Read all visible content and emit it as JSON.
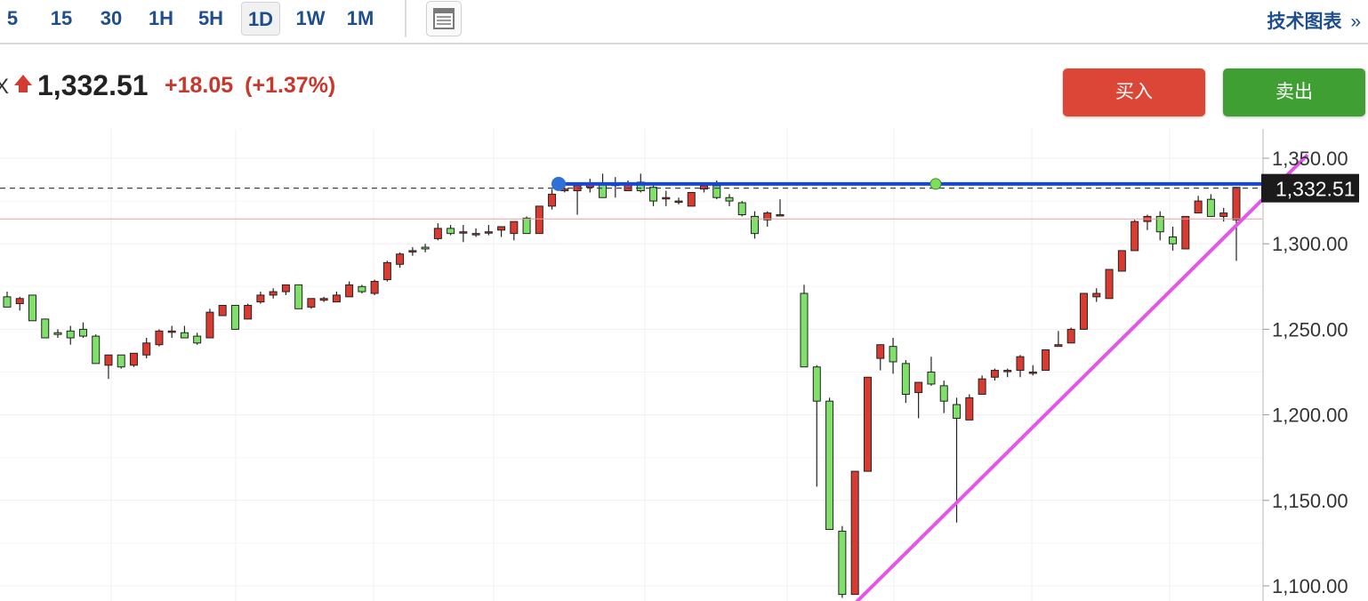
{
  "toolbar": {
    "timeframes": [
      "5",
      "15",
      "30",
      "1H",
      "5H",
      "1D",
      "1W",
      "1M"
    ],
    "active_timeframe": "1D",
    "layout_icon": "layout-icon",
    "tech_chart_label": "技术图表",
    "tech_chart_arrow": "»"
  },
  "quote": {
    "prefix": "X",
    "direction_icon": "up-arrow-icon",
    "last_price": "1,332.51",
    "change": "+18.05",
    "change_pct": "(+1.37%)",
    "up_color": "#c8372c"
  },
  "actions": {
    "buy_label": "买入",
    "sell_label": "卖出",
    "buy_color": "#dc4637",
    "sell_color": "#3f9f33"
  },
  "chart_data": {
    "type": "candlestick",
    "y_axis": {
      "ticks": [
        "1,100.00",
        "1,150.00",
        "1,200.00",
        "1,250.00",
        "1,300.00",
        "1,350.00"
      ],
      "ylim": [
        1092,
        1354
      ],
      "position": "right"
    },
    "current_price_label": "1,332.51",
    "grid": true,
    "up_color": "#d93b30",
    "down_color": "#7fe06a",
    "candles": [
      [
        1269,
        1272,
        1263,
        1263
      ],
      [
        1265,
        1269,
        1261,
        1268
      ],
      [
        1270,
        1270,
        1255,
        1255
      ],
      [
        1256,
        1256,
        1245,
        1245
      ],
      [
        1248,
        1250,
        1245,
        1247
      ],
      [
        1249,
        1252,
        1241,
        1245
      ],
      [
        1250,
        1254,
        1245,
        1246
      ],
      [
        1246,
        1247,
        1230,
        1230
      ],
      [
        1229,
        1234,
        1221,
        1235
      ],
      [
        1235,
        1235,
        1227,
        1228
      ],
      [
        1229,
        1236,
        1228,
        1236
      ],
      [
        1235,
        1245,
        1233,
        1242
      ],
      [
        1241,
        1250,
        1240,
        1249
      ],
      [
        1249,
        1252,
        1245,
        1249
      ],
      [
        1248,
        1252,
        1245,
        1245
      ],
      [
        1246,
        1248,
        1241,
        1242
      ],
      [
        1245,
        1262,
        1245,
        1260
      ],
      [
        1258,
        1264,
        1258,
        1264
      ],
      [
        1264,
        1264,
        1250,
        1250
      ],
      [
        1256,
        1265,
        1256,
        1264
      ],
      [
        1266,
        1272,
        1265,
        1270
      ],
      [
        1270,
        1274,
        1268,
        1272
      ],
      [
        1272,
        1276,
        1270,
        1276
      ],
      [
        1276,
        1276,
        1262,
        1262
      ],
      [
        1263,
        1268,
        1262,
        1268
      ],
      [
        1267,
        1269,
        1266,
        1268
      ],
      [
        1266,
        1272,
        1266,
        1270
      ],
      [
        1269,
        1278,
        1269,
        1276
      ],
      [
        1275,
        1276,
        1271,
        1272
      ],
      [
        1271,
        1279,
        1270,
        1278
      ],
      [
        1279,
        1290,
        1278,
        1289
      ],
      [
        1288,
        1295,
        1286,
        1294
      ],
      [
        1296,
        1298,
        1293,
        1296
      ],
      [
        1298,
        1300,
        1295,
        1297
      ],
      [
        1303,
        1312,
        1302,
        1309
      ],
      [
        1309,
        1311,
        1305,
        1306
      ],
      [
        1307,
        1311,
        1301,
        1307
      ],
      [
        1306,
        1309,
        1304,
        1306
      ],
      [
        1307,
        1311,
        1305,
        1307
      ],
      [
        1308,
        1309,
        1304,
        1310
      ],
      [
        1306,
        1312,
        1302,
        1313
      ],
      [
        1315,
        1316,
        1306,
        1306
      ],
      [
        1306,
        1322,
        1306,
        1322
      ],
      [
        1322,
        1332,
        1320,
        1329
      ],
      [
        1331,
        1337,
        1330,
        1332
      ],
      [
        1331,
        1334,
        1317,
        1334
      ],
      [
        1333,
        1338,
        1330,
        1335
      ],
      [
        1335,
        1341,
        1328,
        1327
      ],
      [
        1335,
        1339,
        1327,
        1334
      ],
      [
        1331,
        1337,
        1331,
        1335
      ],
      [
        1336,
        1341,
        1330,
        1331
      ],
      [
        1333,
        1336,
        1322,
        1325
      ],
      [
        1327,
        1331,
        1322,
        1327
      ],
      [
        1325,
        1327,
        1323,
        1325
      ],
      [
        1322,
        1327,
        1322,
        1330
      ],
      [
        1332,
        1334,
        1330,
        1334
      ],
      [
        1334,
        1337,
        1326,
        1327
      ],
      [
        1327,
        1329,
        1322,
        1325
      ],
      [
        1324,
        1325,
        1316,
        1317
      ],
      [
        1316,
        1319,
        1303,
        1306
      ],
      [
        1314,
        1319,
        1310,
        1318
      ],
      [
        1317,
        1326,
        1317,
        1317
      ],
      [
        1271,
        1276,
        1228,
        1228
      ],
      [
        1228,
        1229,
        1158,
        1208
      ],
      [
        1208,
        1210,
        1133,
        1133
      ],
      [
        1132,
        1135,
        1093,
        1095
      ],
      [
        1095,
        1167,
        1095,
        1167
      ],
      [
        1167,
        1222,
        1167,
        1222
      ],
      [
        1233,
        1240,
        1226,
        1241
      ],
      [
        1240,
        1245,
        1224,
        1231
      ],
      [
        1230,
        1232,
        1207,
        1212
      ],
      [
        1213,
        1219,
        1198,
        1219
      ],
      [
        1225,
        1234,
        1217,
        1218
      ],
      [
        1217,
        1220,
        1201,
        1208
      ],
      [
        1206,
        1210,
        1137,
        1198
      ],
      [
        1197,
        1212,
        1197,
        1210
      ],
      [
        1212,
        1223,
        1212,
        1221
      ],
      [
        1222,
        1227,
        1220,
        1226
      ],
      [
        1226,
        1227,
        1222,
        1226
      ],
      [
        1226,
        1235,
        1222,
        1234
      ],
      [
        1225,
        1229,
        1223,
        1225
      ],
      [
        1226,
        1237,
        1226,
        1238
      ],
      [
        1240,
        1249,
        1240,
        1241
      ],
      [
        1242,
        1251,
        1242,
        1250
      ],
      [
        1250,
        1270,
        1250,
        1271
      ],
      [
        1269,
        1274,
        1266,
        1271
      ],
      [
        1268,
        1285,
        1268,
        1285
      ],
      [
        1284,
        1295,
        1284,
        1296
      ],
      [
        1296,
        1314,
        1296,
        1313
      ],
      [
        1313,
        1317,
        1308,
        1316
      ],
      [
        1316,
        1319,
        1302,
        1307
      ],
      [
        1304,
        1310,
        1296,
        1300
      ],
      [
        1297,
        1316,
        1297,
        1316
      ],
      [
        1318,
        1328,
        1318,
        1325
      ],
      [
        1326,
        1329,
        1316,
        1316
      ],
      [
        1316,
        1321,
        1313,
        1318
      ],
      [
        1314,
        1333,
        1290,
        1333
      ]
    ],
    "drawings": {
      "horizontal_line_price": 1335,
      "horizontal_line_color": "#1446e6",
      "dashed_price_line": 1332.51,
      "trend_line": {
        "from": [
          1093,
          0.7
        ],
        "to": [
          1348,
          1.1
        ],
        "color": "#e455e8"
      }
    }
  }
}
